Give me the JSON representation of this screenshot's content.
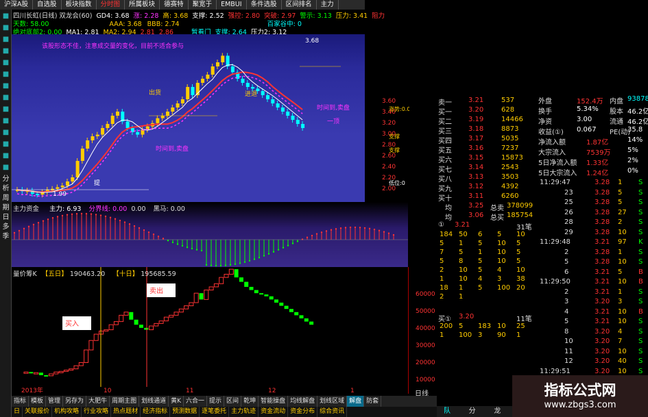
{
  "topbar": {
    "tabs": [
      "沪深A股",
      "自选股",
      "板块指数",
      "分时图",
      "所属板块",
      "德赛特",
      "聚宽于",
      "EMBUI",
      "条件选股",
      "区间排名",
      "主力"
    ]
  },
  "lefttoolbar": {
    "labels": [
      "分",
      "析",
      "周",
      "期",
      "日",
      "多",
      "季"
    ],
    "icons": [
      "home-icon",
      "grid-icon",
      "chart-icon",
      "list-icon",
      "gear-icon",
      "bell-icon",
      "star-icon",
      "flag-icon",
      "search-icon",
      "book-icon",
      "info-icon",
      "user-icon",
      "bar-icon",
      "kline-icon"
    ]
  },
  "info": {
    "row1": [
      "四川长虹(日线) 双龙会(60)",
      "GD4: 3.68",
      "涨: 2.28",
      "高: 3.68",
      "支撑: 2.52",
      "强控: 2.80",
      "突破: 2.97",
      "警示: 3.13",
      "压力: 3.41",
      "阻力"
    ],
    "row2": [
      "天数: 58.00",
      "",
      "",
      "AAA: 3.68",
      "BBB: 2.74",
      "",
      "",
      "",
      "百家谷中: 0"
    ],
    "row3": [
      "绝对底部2: 0.00",
      "MA1: 2.81",
      "MA2: 2.94",
      "2.81",
      "2.86",
      "",
      "暂看门",
      "支撑: 2.64",
      "压力2: 3.12"
    ]
  },
  "chart_labels": {
    "note": "该股形态不佳，注意成交量的变化，目前不适合参与",
    "price_top": "3.68",
    "low_label": "1.99",
    "chuhuo": "出货",
    "jishi1": "时间到,卖盘",
    "jishi2": "时间到,卖盘",
    "yiding": "一顶",
    "tuibian": "进退",
    "xiaban": "涨势",
    "zhicheng": "支撑",
    "zhicheng2": "支撑",
    "dixian": "低位",
    "ti": "提"
  },
  "macd": {
    "title": "主力资金",
    "main": "主力: 6.93",
    "fenjie": "分界线: 0.00",
    "v1": "0.00",
    "heima": "黑马: 0.00"
  },
  "vol": {
    "title": "量价筹K",
    "w5": "【五日】",
    "v5": "190463.20",
    "w10": "【十日】",
    "v10": "195685.59",
    "buy": "买入",
    "sell": "卖出",
    "axis": [
      "60000",
      "50000",
      "40000",
      "30000",
      "20000",
      "10000"
    ],
    "xaxis": [
      "2013年",
      "10",
      "11",
      "12",
      "1"
    ]
  },
  "pricebox": {
    "prices": [
      "3.60",
      "3.40",
      "3.20",
      "3.00",
      "2.80",
      "2.60",
      "2.40",
      "2.20",
      "2.00"
    ],
    "labels": [
      "涨势:0.0",
      "支撑",
      "支撑",
      "低位:0"
    ]
  },
  "order": {
    "sells": [
      [
        "卖一",
        "3.21",
        "537"
      ],
      [
        "买一",
        "3.20",
        "628"
      ],
      [
        "买二",
        "3.19",
        "14466"
      ],
      [
        "买三",
        "3.18",
        "8873"
      ],
      [
        "买四",
        "3.17",
        "5035"
      ],
      [
        "买五",
        "3.16",
        "7237"
      ],
      [
        "买六",
        "3.15",
        "15873"
      ],
      [
        "买七",
        "3.14",
        "2543"
      ],
      [
        "买八",
        "3.13",
        "3503"
      ],
      [
        "买九",
        "3.12",
        "4392"
      ],
      [
        "买十",
        "3.11",
        "6260"
      ]
    ],
    "avg": [
      [
        "均",
        "3.25",
        "总卖",
        "378099"
      ],
      [
        "均",
        "3.06",
        "总买",
        "185754"
      ]
    ],
    "queue_head": [
      "①",
      "3.21",
      "31笔"
    ],
    "queue": [
      [
        "184",
        "50",
        "6",
        "5",
        "10"
      ],
      [
        "5",
        "1",
        "5",
        "10",
        "5"
      ],
      [
        "7",
        "5",
        "1",
        "10",
        "5"
      ],
      [
        "5",
        "8",
        "5",
        "10",
        "5"
      ],
      [
        "2",
        "10",
        "5",
        "4",
        "10"
      ],
      [
        "1",
        "10",
        "4",
        "3",
        "38"
      ],
      [
        "18",
        "1",
        "5",
        "100",
        "20"
      ],
      [
        "2",
        "1",
        "",
        "",
        ""
      ]
    ],
    "buy1": [
      "买①",
      "3.20",
      "11笔"
    ],
    "bqueue": [
      [
        "200",
        "5",
        "183",
        "10",
        "25"
      ],
      [
        "1",
        "100",
        "3",
        "90",
        "1"
      ]
    ]
  },
  "right": {
    "rows": [
      [
        "外盘",
        "152.4万",
        "内盘",
        "938783"
      ],
      [
        "换手",
        "5.34%",
        "股本",
        "46.2亿"
      ],
      [
        "净资",
        "3.00",
        "流通",
        "46.2亿"
      ],
      [
        "收益(①)",
        "0.067",
        "PE(动)",
        "35.8"
      ],
      [
        "净流入额",
        "1.87亿",
        "",
        "14%"
      ],
      [
        "大宗流入",
        "7539万",
        "",
        "5%"
      ],
      [
        "5日净流入额",
        "1.33亿",
        "",
        "2%"
      ],
      [
        "5日大宗流入",
        "1.24亿",
        "",
        "0%"
      ]
    ],
    "ticks": [
      [
        "11:29:47",
        "4",
        "3.28",
        "1",
        "S"
      ],
      [
        "23",
        "",
        "3.28",
        "5",
        "S"
      ],
      [
        "25",
        "",
        "3.28",
        "5",
        "S"
      ],
      [
        "26",
        "",
        "3.28",
        "27",
        "S"
      ],
      [
        "28",
        "",
        "3.28",
        "2",
        "S"
      ],
      [
        "29",
        "",
        "3.28",
        "10",
        "S"
      ],
      [
        "11:29:48",
        "",
        "3.21",
        "97",
        "K"
      ],
      [
        "2",
        "",
        "3.28",
        "1",
        "S"
      ],
      [
        "5",
        "",
        "3.28",
        "10",
        "S"
      ],
      [
        "6",
        "",
        "3.21",
        "5",
        "B"
      ],
      [
        "11:29:50",
        "",
        "3.21",
        "10",
        "B"
      ],
      [
        "2",
        "",
        "3.21",
        "1",
        "S"
      ],
      [
        "3",
        "",
        "3.20",
        "3",
        "S"
      ],
      [
        "4",
        "",
        "3.21",
        "10",
        "B"
      ],
      [
        "5",
        "",
        "3.21",
        "10",
        "S"
      ],
      [
        "8",
        "",
        "3.20",
        "4",
        "S"
      ],
      [
        "10",
        "",
        "3.20",
        "7",
        "S"
      ],
      [
        "11",
        "",
        "3.20",
        "10",
        "S"
      ],
      [
        "12",
        "",
        "3.20",
        "40",
        "S"
      ],
      [
        "11:29:51",
        "",
        "3.20",
        "10",
        "S"
      ]
    ]
  },
  "botbar": {
    "tabs1": [
      "指标",
      "模板",
      "管理",
      "另存为",
      "大肥牛",
      "周期主图",
      "划线通道",
      "黄K",
      "六合一",
      "提示",
      "区间",
      "乾坤",
      "智能操盘",
      "均线解盘",
      "划线区域",
      "解盘",
      "防套"
    ],
    "tabs2": [
      "日",
      "关联报价",
      "机构攻略",
      "行业攻略",
      "热点题材",
      "经济指标",
      "预测数据",
      "逐笔委托",
      "主力轨迹",
      "资金流动",
      "资金分布",
      "综合资讯"
    ],
    "right_tabs": [
      "队列",
      "分布",
      "龙虎"
    ],
    "riban": "日线"
  },
  "watermark": {
    "title": "指标公式网",
    "url": "www.zbgs3.com"
  },
  "colors": {
    "red": "#ff3030",
    "green": "#00ff00",
    "yellow": "#ffd700",
    "cyan": "#00e5ee",
    "magenta": "#ff40ff",
    "blue_bg": "#2a2a9a"
  }
}
